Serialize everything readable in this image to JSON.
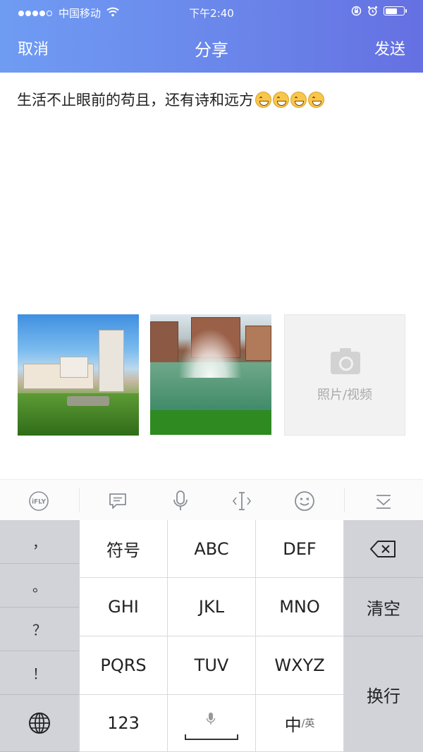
{
  "status_bar": {
    "carrier": "中国移动",
    "time": "下午2:40",
    "signal_bars": 4,
    "battery_level": 0.7
  },
  "nav": {
    "cancel": "取消",
    "title": "分享",
    "send": "发送"
  },
  "compose": {
    "text": "生活不止眼前的苟且，还有诗和远方",
    "emojis": [
      "grin-icon",
      "grin-icon",
      "tears-of-joy-icon",
      "smile-icon"
    ]
  },
  "media": {
    "photos": [
      "apartment-buildings-photo",
      "fountain-photo"
    ],
    "add_label": "照片/视频"
  },
  "toolbar": {
    "items": [
      "ifly-logo-icon",
      "message-icon",
      "microphone-icon",
      "text-cursor-icon",
      "emoji-face-icon",
      "collapse-keyboard-icon"
    ],
    "ifly_text": "iFLY"
  },
  "keyboard": {
    "punctuation": [
      "，",
      "。",
      "？",
      "！"
    ],
    "rows": [
      [
        "符号",
        "ABC",
        "DEF"
      ],
      [
        "GHI",
        "JKL",
        "MNO"
      ],
      [
        "PQRS",
        "TUV",
        "WXYZ"
      ]
    ],
    "bottom": {
      "numbers": "123",
      "lang_main": "中",
      "lang_sub": "/英"
    },
    "right": {
      "clear": "清空",
      "enter": "换行"
    }
  },
  "colors": {
    "header_start": "#6f9cf3",
    "header_end": "#6570e2",
    "keyboard_bg": "#d1d3d9"
  }
}
